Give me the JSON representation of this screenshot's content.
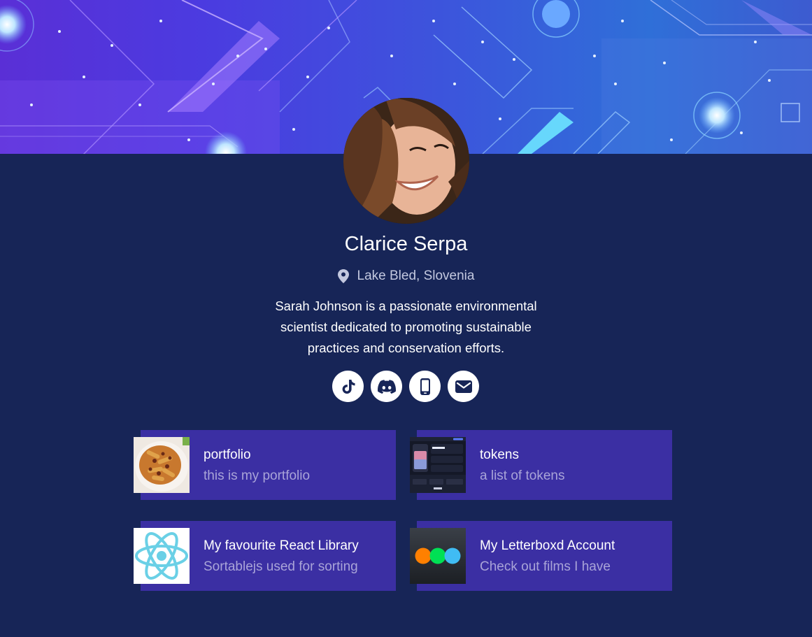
{
  "profile": {
    "name": "Clarice Serpa",
    "location": "Lake Bled, Slovenia",
    "bio": "Sarah Johnson is a passionate environmental scientist dedicated to promoting sustainable practices and conservation efforts."
  },
  "socials": [
    {
      "icon": "tiktok-icon"
    },
    {
      "icon": "discord-icon"
    },
    {
      "icon": "phone-icon"
    },
    {
      "icon": "mail-icon"
    }
  ],
  "links": [
    {
      "title": "portfolio",
      "description": "this is my portfolio",
      "thumbnail": "pasta-dish-image"
    },
    {
      "title": "tokens",
      "description": "a list of tokens",
      "thumbnail": "crypto-app-screenshot"
    },
    {
      "title": "My favourite React Library",
      "description": "Sortablejs used for sorting",
      "thumbnail": "react-logo"
    },
    {
      "title": "My Letterboxd Account",
      "description": "Check out films I have",
      "thumbnail": "letterboxd-logo"
    }
  ],
  "colors": {
    "page_background": "#172557",
    "card_background": "#3b2fa3",
    "card_description": "#a9a4d8"
  }
}
